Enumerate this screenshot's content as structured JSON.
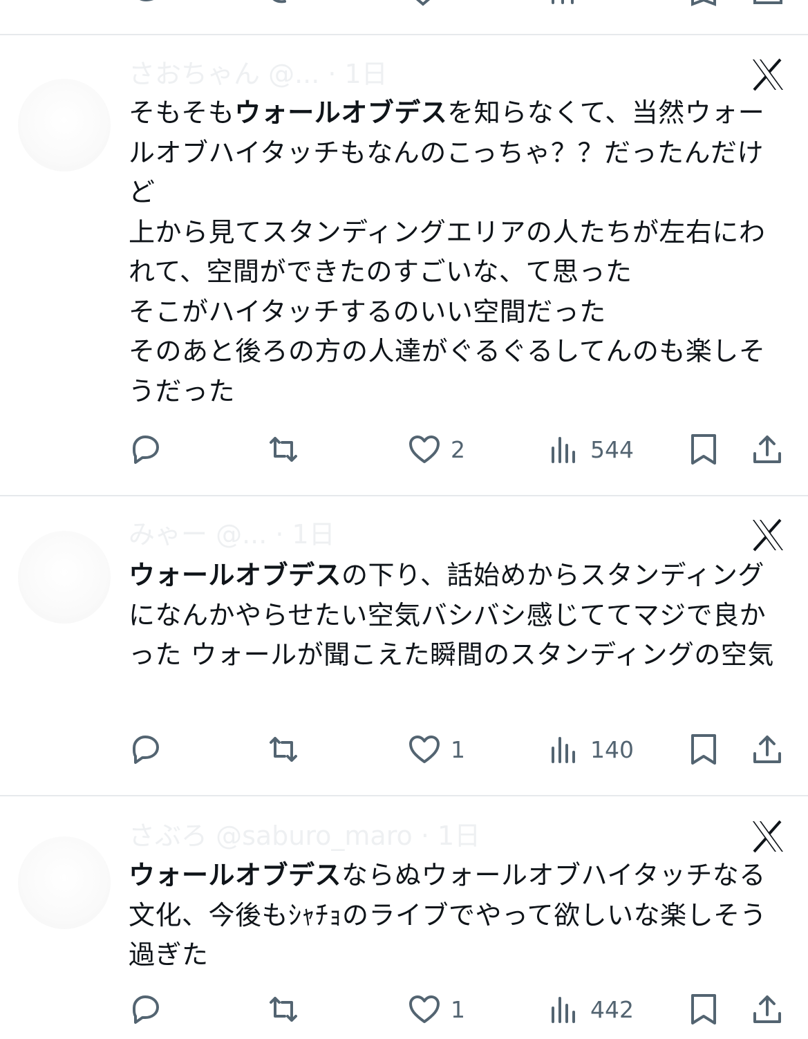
{
  "tweets": [
    {
      "author_faded": "さおちゃん @... · 1日",
      "text_bold_1": "ウォールオブデス",
      "text_after_1": "を知らなくて、当然ウォールオブハイタッチもなんのこっちゃ？？だったんだけど\n上から見てスタンディングエリアの人たちが左右にわれて、空間ができたのすごいな、て思った\nそこがハイタッチするのいい空間だった\nそのあと後ろの方の人達がぐるぐるしてんのも楽しそうだった",
      "text_before_1": "そもそも",
      "likes": "2",
      "views": "544"
    },
    {
      "author_faded": "みゃー @... · 1日",
      "text_before_1": "",
      "text_bold_1": "ウォールオブデス",
      "text_after_1": "の下り、話始めからスタンディングになんかやらせたい空気バシバシ感じててマジで良かった ウォールが聞こえた瞬間のスタンディングの空気",
      "likes": "1",
      "views": "140"
    },
    {
      "author_faded": "さぶろ @saburo_maro · 1日",
      "text_before_1": "",
      "text_bold_1": "ウォールオブデス",
      "text_after_1": "ならぬウォールオブハイタッチなる文化、今後もｼｬﾁｮのライブでやって欲しいな楽しそう過ぎた",
      "likes": "1",
      "views": "442"
    }
  ],
  "icons": {
    "reply": "reply-icon",
    "retweet": "retweet-icon",
    "like": "heart-icon",
    "views": "views-icon",
    "bookmark": "bookmark-icon",
    "share": "share-icon",
    "platform": "x-logo-icon"
  },
  "colors": {
    "icon": "#536471",
    "text": "#0f1419",
    "divider": "#e6e9ec"
  }
}
